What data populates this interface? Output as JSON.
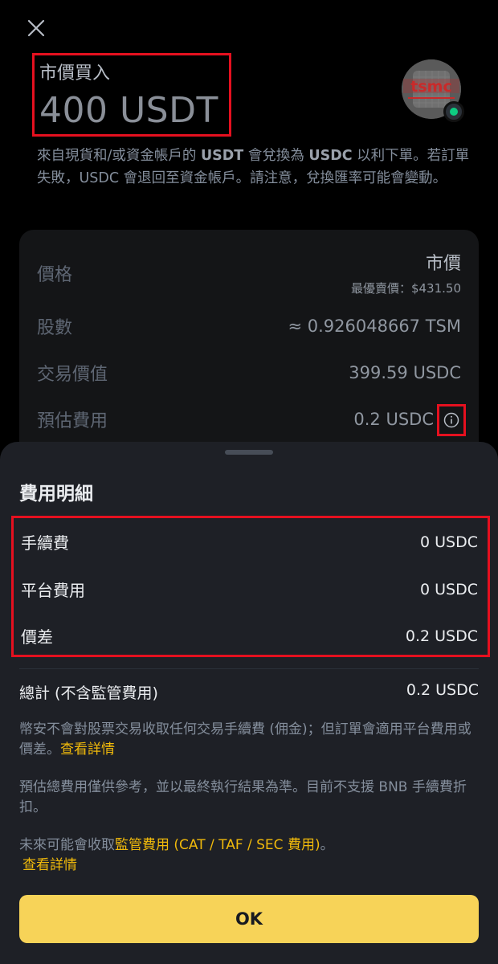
{
  "header": {
    "order_type": "市價買入",
    "amount": "400 USDT",
    "stock_logo_text": "tsmc"
  },
  "notice": {
    "part1": "來自現貨和/或資金帳戶的 ",
    "token_from": "USDT",
    "part2": " 會兌換為 ",
    "token_to": "USDC",
    "part3": " 以利下單。若訂單失敗，USDC 會退回至資金帳戶。請注意，兌換匯率可能會變動。"
  },
  "order": {
    "price_label": "價格",
    "price_value": "市價",
    "best_ask": "最優賣價：$431.50",
    "shares_label": "股數",
    "shares_value": "≈ 0.926048667 TSM",
    "trade_value_label": "交易價值",
    "trade_value": "399.59 USDC",
    "est_fee_label": "預估費用",
    "est_fee_value": "0.2 USDC"
  },
  "fee_sheet": {
    "title": "費用明細",
    "rows": [
      {
        "label": "手續費",
        "value": "0 USDC"
      },
      {
        "label": "平台費用",
        "value": "0 USDC"
      },
      {
        "label": "價差",
        "value": "0.2 USDC"
      }
    ],
    "total_label": "總計 (不含監管費用)",
    "total_value": "0.2 USDC",
    "para1": "幣安不會對股票交易收取任何交易手續費 (佣金)；但訂單會適用平台費用或價差。",
    "para1_link": "查看詳情",
    "para2": "預估總費用僅供參考，並以最終執行結果為準。目前不支援 BNB 手續費折扣。",
    "para3": "未來可能會收取",
    "para3_link": "監管費用 (CAT / TAF / SEC 費用)",
    "para3_end": "。",
    "para3_link2": "查看詳情",
    "ok_label": "OK"
  },
  "colors": {
    "accent": "#f0b90b",
    "button": "#f7d358",
    "highlight_box": "#e5101f",
    "sheet_bg": "#1e2026"
  }
}
